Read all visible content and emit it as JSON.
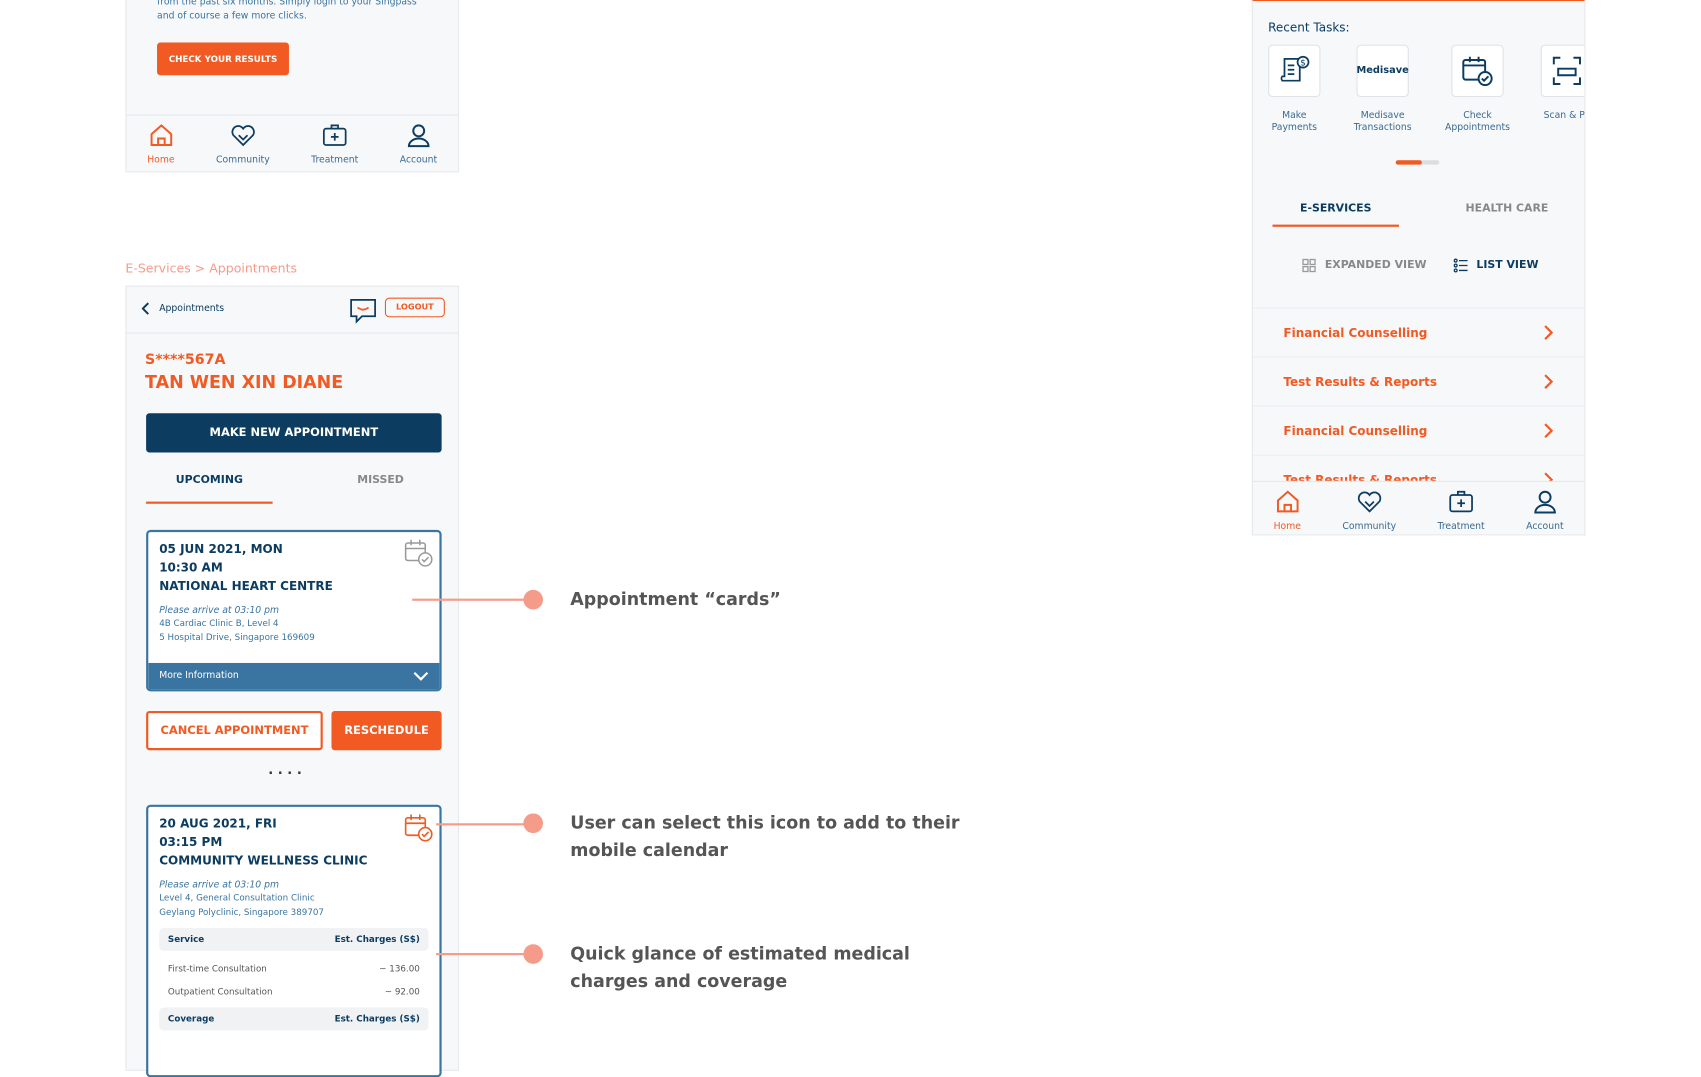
{
  "top_panel": {
    "intro_text": "from the past six months. Simply login to your Singpass and of course a few more clicks.",
    "check_results_label": "CHECK YOUR RESULTS"
  },
  "bottom_nav": [
    {
      "label": "Home",
      "icon": "home-icon",
      "active": true
    },
    {
      "label": "Community",
      "icon": "heart-handshake-icon"
    },
    {
      "label": "Treatment",
      "icon": "medical-kit-icon"
    },
    {
      "label": "Account",
      "icon": "user-icon"
    }
  ],
  "breadcrumb": "E-Services > Appointments",
  "appointments": {
    "back_label": "Appointments",
    "logout_label": "LOGOUT",
    "patient_id": "S****567A",
    "patient_name": "TAN WEN XIN DIANE",
    "new_appointment_label": "MAKE NEW APPOINTMENT",
    "tabs": [
      "UPCOMING",
      "MISSED"
    ],
    "card1": {
      "date": "05 JUN 2021, MON",
      "time": "10:30 AM",
      "location": "NATIONAL HEART CENTRE",
      "arrive": "Please arrive at 03:10 pm",
      "address1": "4B Cardiac Clinic B, Level 4",
      "address2": "5 Hospital Drive, Singapore 169609",
      "more": "More Information"
    },
    "cancel_label": "CANCEL APPOINTMENT",
    "reschedule_label": "RESCHEDULE",
    "dots": ". . . .",
    "card2": {
      "date": "20 AUG 2021, FRI",
      "time": "03:15 PM",
      "location": "COMMUNITY WELLNESS CLINIC",
      "arrive": "Please arrive at 03:10 pm",
      "address1": "Level 4, General Consultation Clinic",
      "address2": "Geylang Polyclinic, Singapore 389707",
      "service_header": "Service",
      "charges_header": "Est. Charges (S$)",
      "rows": [
        {
          "service": "First-time Consultation",
          "charge": "~ 136.00"
        },
        {
          "service": "Outpatient Consultation",
          "charge": "~ 92.00"
        }
      ],
      "coverage_header": "Coverage",
      "coverage_charges_header": "Est. Charges (S$)"
    }
  },
  "annotations": [
    "Appointment “cards”",
    "User can select this icon to add to their mobile calendar",
    "Quick glance of estimated medical charges and coverage"
  ],
  "right_panel": {
    "recent_tasks_title": "Recent Tasks:",
    "tasks": [
      {
        "label": "Make Payments",
        "icon": "payment-bill-icon"
      },
      {
        "label": "Medisave Transactions",
        "icon": "medisave-logo"
      },
      {
        "label": "Check Appointments",
        "icon": "calendar-check-icon"
      },
      {
        "label": "Scan & Pa",
        "icon": "scan-icon"
      }
    ],
    "medisave_logo_text": "Medisave",
    "tabs": [
      "E-SERVICES",
      "HEALTH CARE"
    ],
    "expanded_view_label": "EXPANDED VIEW",
    "list_view_label": "LIST VIEW",
    "services": [
      "Financial Counselling",
      "Test Results & Reports",
      "Financial Counselling",
      "Test Results & Reports"
    ]
  },
  "colors": {
    "accent": "#f15a22",
    "navy": "#0c3c60",
    "card_blue": "#3a74a0",
    "annotation": "#f59b8a"
  }
}
